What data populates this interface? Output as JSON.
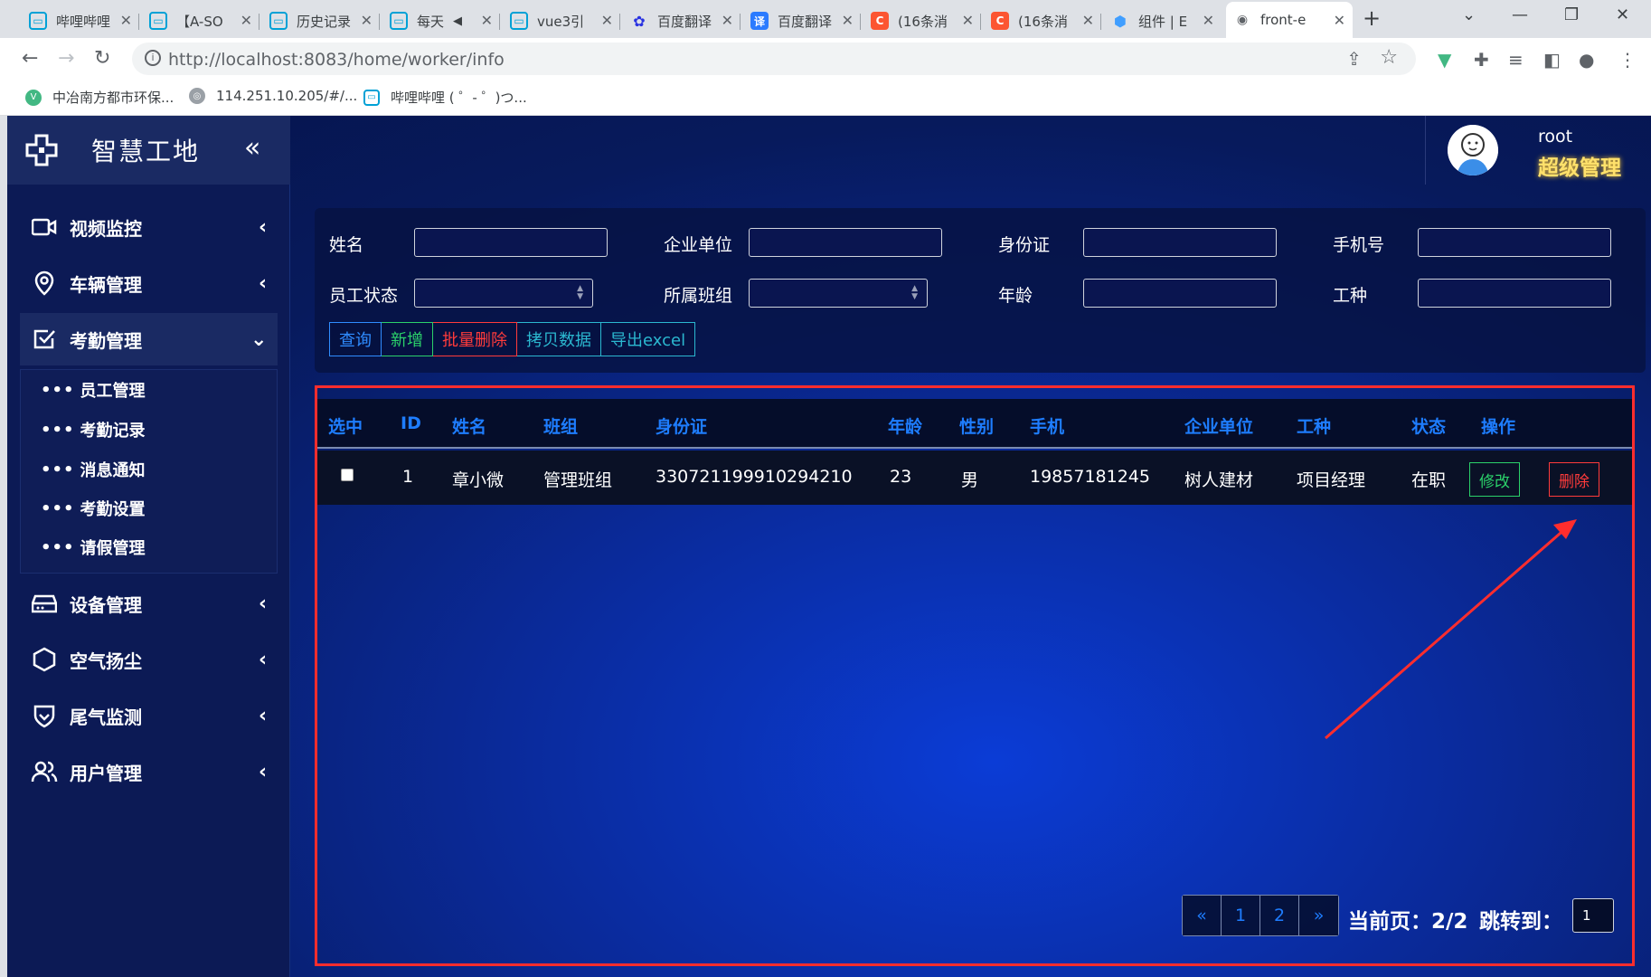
{
  "browser": {
    "tabs": [
      {
        "title": "哔哩哔哩",
        "icon": "bilibili-icon",
        "color": "#00a1d6"
      },
      {
        "title": "【A-SO",
        "icon": "bilibili-icon",
        "color": "#00a1d6"
      },
      {
        "title": "历史记录",
        "icon": "bilibili-icon",
        "color": "#00a1d6"
      },
      {
        "title": "每天",
        "icon": "bilibili-icon",
        "color": "#00a1d6"
      },
      {
        "title": "vue3引",
        "icon": "bilibili-icon",
        "color": "#00a1d6"
      },
      {
        "title": "百度翻译",
        "icon": "baidu-paw-icon",
        "color": "#2932e1"
      },
      {
        "title": "百度翻译",
        "icon": "translate-icon",
        "color": "#2b7bff"
      },
      {
        "title": "(16条消",
        "icon": "csdn-icon",
        "color": "#fc5531"
      },
      {
        "title": "(16条消",
        "icon": "csdn-icon",
        "color": "#fc5531"
      },
      {
        "title": "组件 | E",
        "icon": "element-icon",
        "color": "#409eff"
      },
      {
        "title": "front-e",
        "icon": "page-icon",
        "color": "#5f6368"
      }
    ],
    "url": "http://localhost:8083/home/worker/info",
    "bookmarks": [
      {
        "label": "中冶南方都市环保...",
        "icon": "vue-icon"
      },
      {
        "label": "114.251.10.205/#/...",
        "icon": "globe-icon"
      },
      {
        "label": "哔哩哔哩 ( ゜- ゜)つ...",
        "icon": "bilibili-icon"
      }
    ]
  },
  "app": {
    "title": "智慧工地",
    "user": {
      "name": "root",
      "role": "超级管理"
    },
    "menu": [
      {
        "label": "视频监控",
        "icon": "video-icon"
      },
      {
        "label": "车辆管理",
        "icon": "location-icon"
      },
      {
        "label": "考勤管理",
        "icon": "checkbox-icon",
        "open": true
      },
      {
        "label": "设备管理",
        "icon": "device-icon"
      },
      {
        "label": "空气扬尘",
        "icon": "hexagon-icon"
      },
      {
        "label": "尾气监测",
        "icon": "shield-icon"
      },
      {
        "label": "用户管理",
        "icon": "users-icon"
      }
    ],
    "submenu": [
      "员工管理",
      "考勤记录",
      "消息通知",
      "考勤设置",
      "请假管理"
    ],
    "filters": {
      "name": "姓名",
      "company": "企业单位",
      "idcard": "身份证",
      "phone": "手机号",
      "status": "员工状态",
      "team": "所属班组",
      "age": "年龄",
      "worktype": "工种"
    },
    "buttons": {
      "query": "查询",
      "add": "新增",
      "batch_delete": "批量删除",
      "copy": "拷贝数据",
      "export": "导出excel"
    },
    "table": {
      "headers": [
        "选中",
        "ID",
        "姓名",
        "班组",
        "身份证",
        "年龄",
        "性别",
        "手机",
        "企业单位",
        "工种",
        "状态",
        "操作"
      ],
      "rows": [
        {
          "id": "1",
          "name": "章小微",
          "team": "管理班组",
          "idcard": "330721199910294210",
          "age": "23",
          "gender": "男",
          "phone": "19857181245",
          "company": "树人建材",
          "worktype": "项目经理",
          "status": "在职",
          "edit": "修改",
          "delete": "删除"
        }
      ]
    },
    "pager": {
      "prev": "«",
      "pages": [
        "1",
        "2"
      ],
      "next": "»",
      "current_label": "当前页：2/2",
      "jump_label": "跳转到：",
      "jump_value": "1"
    }
  }
}
